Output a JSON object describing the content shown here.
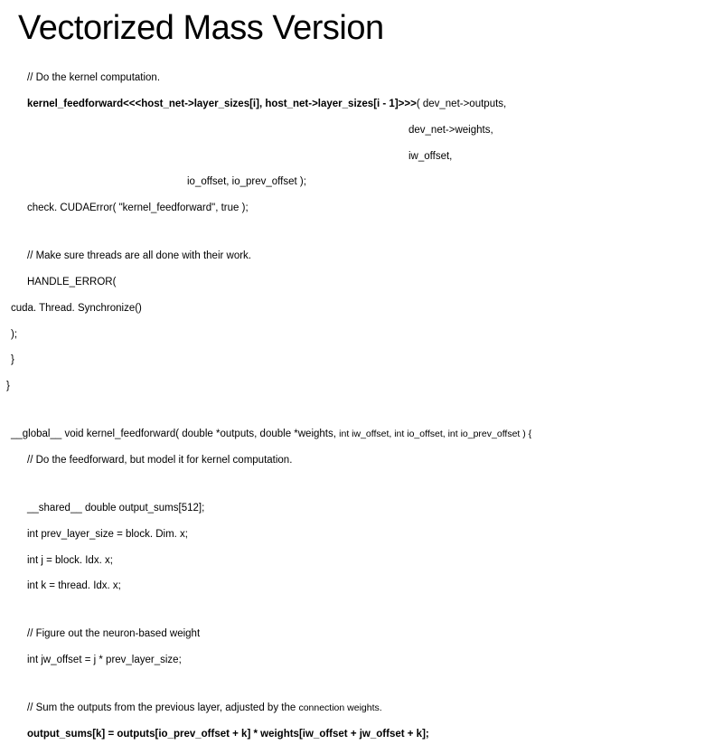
{
  "title": "Vectorized Mass Version",
  "lines": {
    "l1": "// Do the kernel computation.",
    "l2a": "kernel_feedforward<<<host_net->layer_sizes[i], host_net->layer_sizes[i - 1]>>>",
    "l2b": "( dev_net->outputs,",
    "l3": "dev_net->weights,",
    "l4": "iw_offset,",
    "l5": "io_offset, io_prev_offset );",
    "l6": "check. CUDAError( \"kernel_feedforward\", true );",
    "l7": "// Make sure threads are all done with their work.",
    "l8": "HANDLE_ERROR(",
    "l9": "cuda. Thread. Synchronize()",
    "l10": ");",
    "l11": "}",
    "l12": "}",
    "l13a": "__global__ void kernel_feedforward( double *outputs, double *weights, ",
    "l13b": "int iw_offset, int io_offset, int io_prev_offset ) {",
    "l14": "// Do the feedforward, but model it for kernel computation.",
    "l15": "__shared__ double output_sums[512];",
    "l16": "int prev_layer_size = block. Dim. x;",
    "l17": "int j = block. Idx. x;",
    "l18": "int k = thread. Idx. x;",
    "l19": "// Figure out the neuron-based weight",
    "l20": "int jw_offset = j * prev_layer_size;",
    "l21": "// Sum the outputs from the previous layer, adjusted by the ",
    "l21b": "connection weights.",
    "l22": "output_sums[k] = outputs[io_prev_offset + k] * weights[iw_offset + jw_offset + k];"
  }
}
